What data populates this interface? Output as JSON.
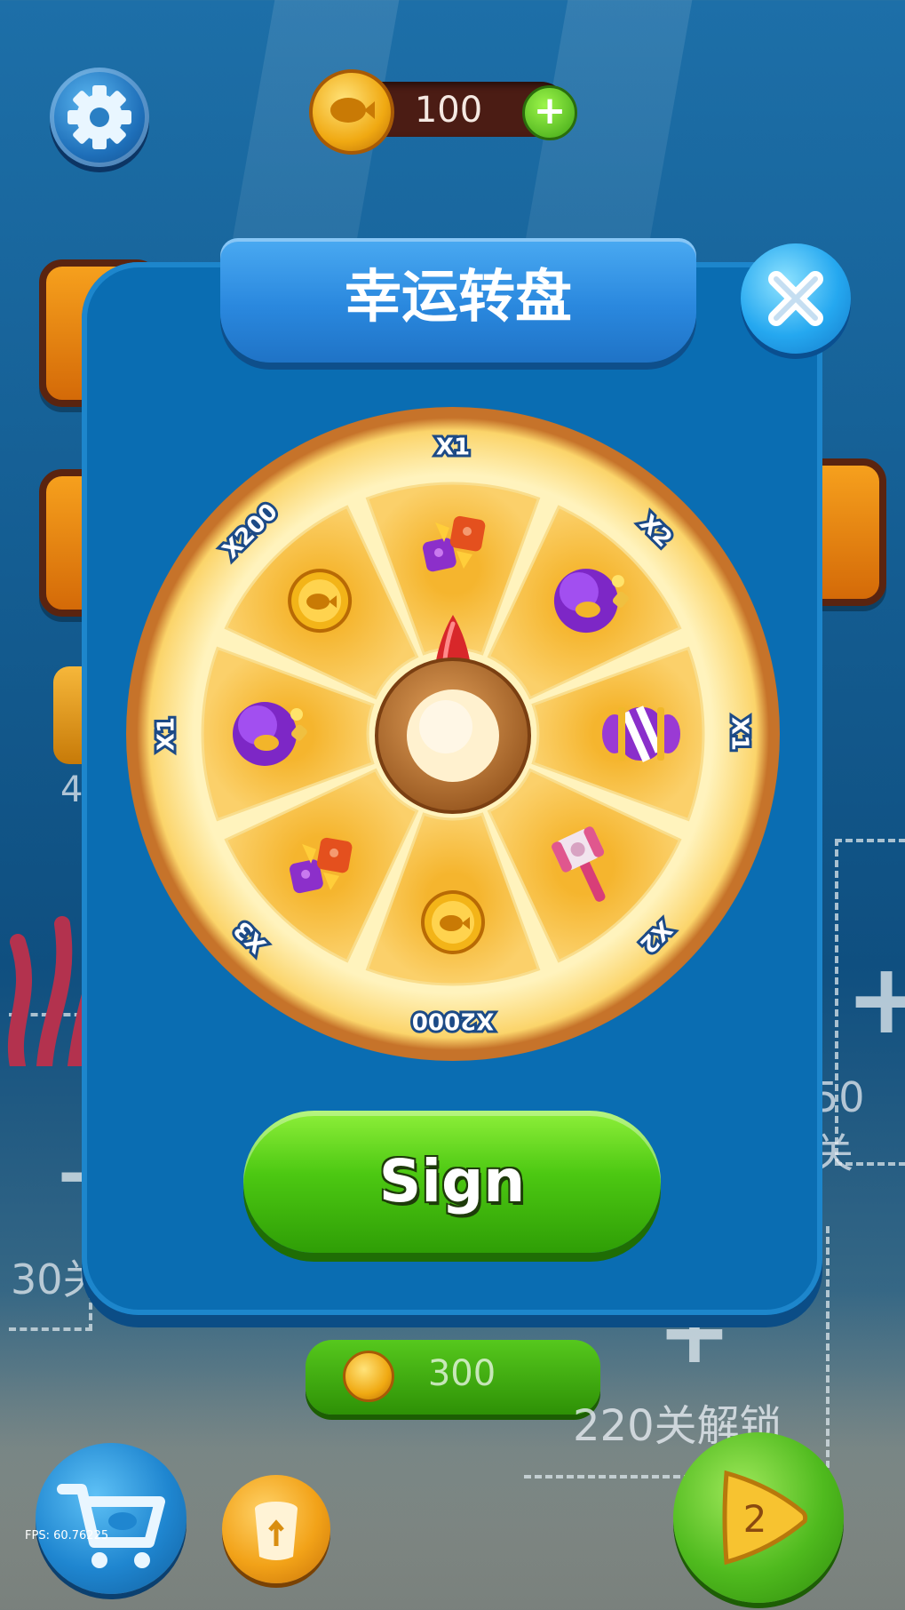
{
  "hud": {
    "coins": "100",
    "icons": [
      "gear-icon",
      "coin-icon",
      "plus-icon"
    ]
  },
  "background": {
    "left_label": "30关",
    "right_label": "50关",
    "partial_number": "4"
  },
  "dialog": {
    "title": "幸运转盘",
    "wheel": {
      "segments": [
        {
          "label": "X1",
          "prize": "candy-cubes"
        },
        {
          "label": "X2",
          "prize": "purple-bomb"
        },
        {
          "label": "X1",
          "prize": "striped-candy"
        },
        {
          "label": "X2",
          "prize": "hammer"
        },
        {
          "label": "X2000",
          "prize": "gold-coin"
        },
        {
          "label": "X3",
          "prize": "candy-cubes"
        },
        {
          "label": "X1",
          "prize": "purple-bomb"
        },
        {
          "label": "X200",
          "prize": "gold-coin"
        }
      ]
    },
    "sign_button": "Sign"
  },
  "bottom": {
    "price": "300",
    "unlock_label": "220关解锁",
    "next_level": "2",
    "icons": [
      "shop-cart-icon",
      "recycle-icon",
      "play-icon"
    ]
  },
  "fps": "FPS: 60.76225",
  "colors": {
    "panel": "#0a6db2",
    "title_tab": "#2a88de",
    "sign_green": "#4cc812",
    "wheel_gold": "#fbcf5c"
  }
}
